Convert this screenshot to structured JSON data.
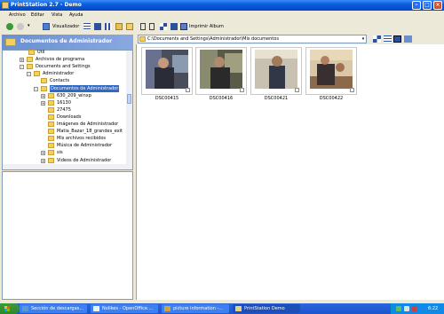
{
  "window": {
    "title": "PrintStation 2.7 - Demo"
  },
  "menu": [
    "Archivo",
    "Editar",
    "Vista",
    "Ayuda"
  ],
  "toolbar": {
    "view_label": "Visualizador",
    "print_label": "Imprimir Album"
  },
  "left_panel": {
    "header": "Documentos de Administrador",
    "tree": [
      {
        "label": "Util",
        "expander": ""
      },
      {
        "label": "Archivos de programa",
        "expander": "+"
      },
      {
        "label": "Documents and Settings",
        "expander": "-"
      },
      {
        "label": "Administrador",
        "expander": "-"
      },
      {
        "label": "Contacts",
        "expander": ""
      },
      {
        "label": "Documentos de Administrador",
        "expander": "-"
      },
      {
        "label": "630_209_winxp",
        "expander": "+"
      },
      {
        "label": "16130",
        "expander": "+"
      },
      {
        "label": "27475",
        "expander": ""
      },
      {
        "label": "Downloads",
        "expander": ""
      },
      {
        "label": "Imágenes de Administrador",
        "expander": ""
      },
      {
        "label": "Matia_Bazar_18_grandes_exit",
        "expander": ""
      },
      {
        "label": "Mis archivos recibidos",
        "expander": ""
      },
      {
        "label": "Música de Administrador",
        "expander": ""
      },
      {
        "label": "sis",
        "expander": "+"
      },
      {
        "label": "Videos de Administrador",
        "expander": "+"
      }
    ]
  },
  "address": {
    "path": "C:\\Documents and Settings\\Administrador\\Mis documentos"
  },
  "thumbnails": [
    {
      "label": "DSC00415"
    },
    {
      "label": "DSC00416"
    },
    {
      "label": "DSC00421"
    },
    {
      "label": "DSC00422"
    }
  ],
  "taskbar": {
    "tasks": [
      {
        "label": "Sección de descargas..."
      },
      {
        "label": "Nolikes - OpenOffice...."
      },
      {
        "label": "picture information -..."
      },
      {
        "label": "PrintStation Demo"
      }
    ],
    "clock": "6:22"
  },
  "colors": {
    "titlebar": "#0a5ee0",
    "selection": "#316ac5",
    "taskbar": "#245edb",
    "start": "#2c8a2c"
  }
}
